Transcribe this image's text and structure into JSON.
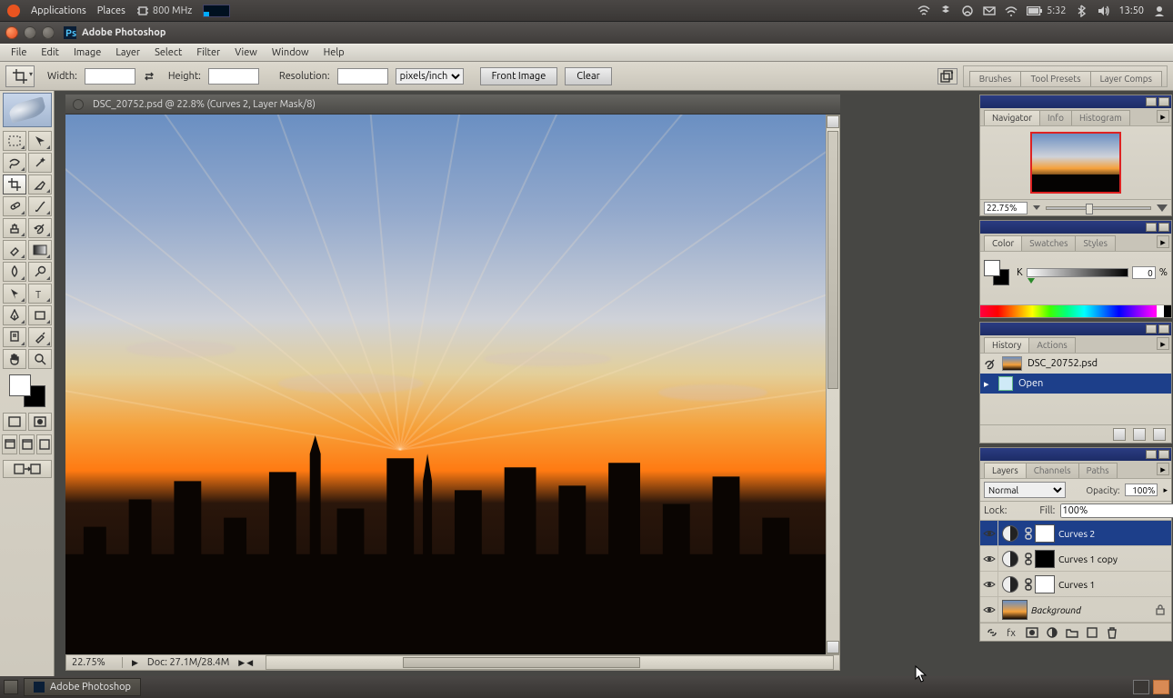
{
  "ubuntu_panel": {
    "applications": "Applications",
    "places": "Places",
    "cpu": "800 MHz",
    "battery_time": "5:32",
    "clock": "13:50"
  },
  "ps": {
    "title": "Adobe Photoshop",
    "menus": [
      "File",
      "Edit",
      "Image",
      "Layer",
      "Select",
      "Filter",
      "View",
      "Window",
      "Help"
    ],
    "options": {
      "width_label": "Width:",
      "width_value": "",
      "height_label": "Height:",
      "height_value": "",
      "resolution_label": "Resolution:",
      "resolution_value": "",
      "units": "pixels/inch",
      "btn_front_image": "Front Image",
      "btn_clear": "Clear",
      "right_tabs": [
        "Brushes",
        "Tool Presets",
        "Layer Comps"
      ]
    },
    "document": {
      "title": "DSC_20752.psd @ 22.8% (Curves 2, Layer Mask/8)",
      "status_zoom": "22.75%",
      "status_doc": "Doc: 27.1M/28.4M"
    },
    "panels": {
      "navigator": {
        "tabs": [
          "Navigator",
          "Info",
          "Histogram"
        ],
        "zoom": "22.75%"
      },
      "color": {
        "tabs": [
          "Color",
          "Swatches",
          "Styles"
        ],
        "channel": "K",
        "value": "0",
        "pct": "%"
      },
      "history": {
        "tabs": [
          "History",
          "Actions"
        ],
        "snapshot": "DSC_20752.psd",
        "items": [
          {
            "label": "Open",
            "selected": true
          }
        ]
      },
      "layers": {
        "tabs": [
          "Layers",
          "Channels",
          "Paths"
        ],
        "blend_mode": "Normal",
        "opacity_label": "Opacity:",
        "opacity_value": "100%",
        "lock_label": "Lock:",
        "fill_label": "Fill:",
        "fill_value": "100%",
        "items": [
          {
            "name": "Curves 2",
            "type": "adjustment",
            "mask": "white",
            "selected": true
          },
          {
            "name": "Curves 1 copy",
            "type": "adjustment",
            "mask": "black",
            "selected": false
          },
          {
            "name": "Curves 1",
            "type": "adjustment",
            "mask": "white",
            "selected": false
          },
          {
            "name": "Background",
            "type": "image",
            "locked": true,
            "italic": true,
            "selected": false
          }
        ]
      }
    }
  },
  "taskbar": {
    "app": "Adobe Photoshop"
  }
}
